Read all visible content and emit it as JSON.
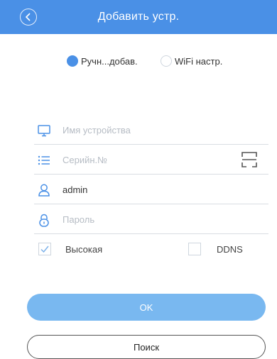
{
  "header": {
    "title": "Добавить устр.",
    "back_icon": "chevron-left-icon"
  },
  "mode": {
    "manual_label": "Ручн...добав.",
    "wifi_label": "WiFi настр.",
    "selected": "manual"
  },
  "form": {
    "device_name_placeholder": "Имя устройства",
    "serial_placeholder": "Серийн.№",
    "username_value": "admin",
    "password_placeholder": "Пароль"
  },
  "options": {
    "high_label": "Высокая",
    "high_checked": true,
    "ddns_label": "DDNS",
    "ddns_checked": false
  },
  "buttons": {
    "ok_label": "OK",
    "search_label": "Поиск"
  },
  "colors": {
    "accent": "#4a90e6",
    "ok_button": "#79b8f0"
  }
}
